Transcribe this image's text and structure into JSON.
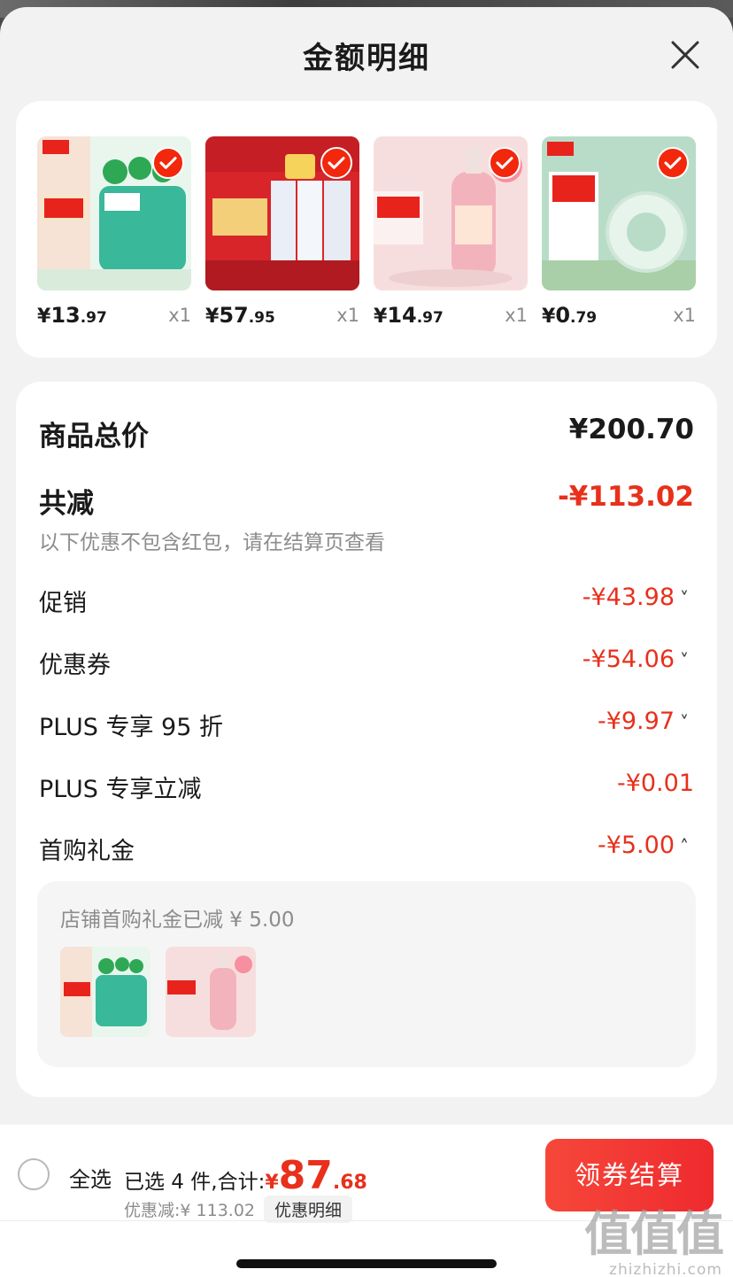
{
  "sheet": {
    "title": "金额明细"
  },
  "products": [
    {
      "price_symbol": "¥",
      "price_int": "13",
      "price_dec": ".97",
      "qty": "x1",
      "icon": "laundry-pods-product-image"
    },
    {
      "price_symbol": "¥",
      "price_int": "57",
      "price_dec": ".95",
      "qty": "x1",
      "icon": "milk-box-product-image"
    },
    {
      "price_symbol": "¥",
      "price_int": "14",
      "price_dec": ".97",
      "qty": "x1",
      "icon": "hand-soap-product-image"
    },
    {
      "price_symbol": "¥",
      "price_int": "0",
      "price_dec": ".79",
      "qty": "x1",
      "icon": "tape-roll-product-image"
    }
  ],
  "summary": {
    "total_label": "商品总价",
    "total_value": "¥200.70",
    "reduce_label": "共减",
    "reduce_value": "-¥113.02",
    "reduce_note": "以下优惠不包含红包，请在结算页查看",
    "lines": [
      {
        "label": "促销",
        "value": "-¥43.98",
        "chevron": "˅"
      },
      {
        "label": "优惠券",
        "value": "-¥54.06",
        "chevron": "˅"
      },
      {
        "label": "PLUS 专享 95 折",
        "value": "-¥9.97",
        "chevron": "˅"
      },
      {
        "label": "PLUS 专享立减",
        "value": "-¥0.01",
        "chevron": ""
      },
      {
        "label": "首购礼金",
        "value": "-¥5.00",
        "chevron": "˄"
      }
    ],
    "gift_note": "店铺首购礼金已减 ¥ 5.00"
  },
  "bottom": {
    "select_all": "全选",
    "selected_text": "已选 4 件,合计:",
    "total_symbol": "¥",
    "total_int": "87",
    "total_dec": ".68",
    "discount_text": "优惠减:¥ 113.02",
    "detail_chip": "优惠明细",
    "checkout": "领券结算"
  },
  "watermark": {
    "main": "值值值",
    "sub": "zhizhizhi.com"
  },
  "colors": {
    "accent_red": "#e8301b",
    "button_red": "#f2270c"
  }
}
